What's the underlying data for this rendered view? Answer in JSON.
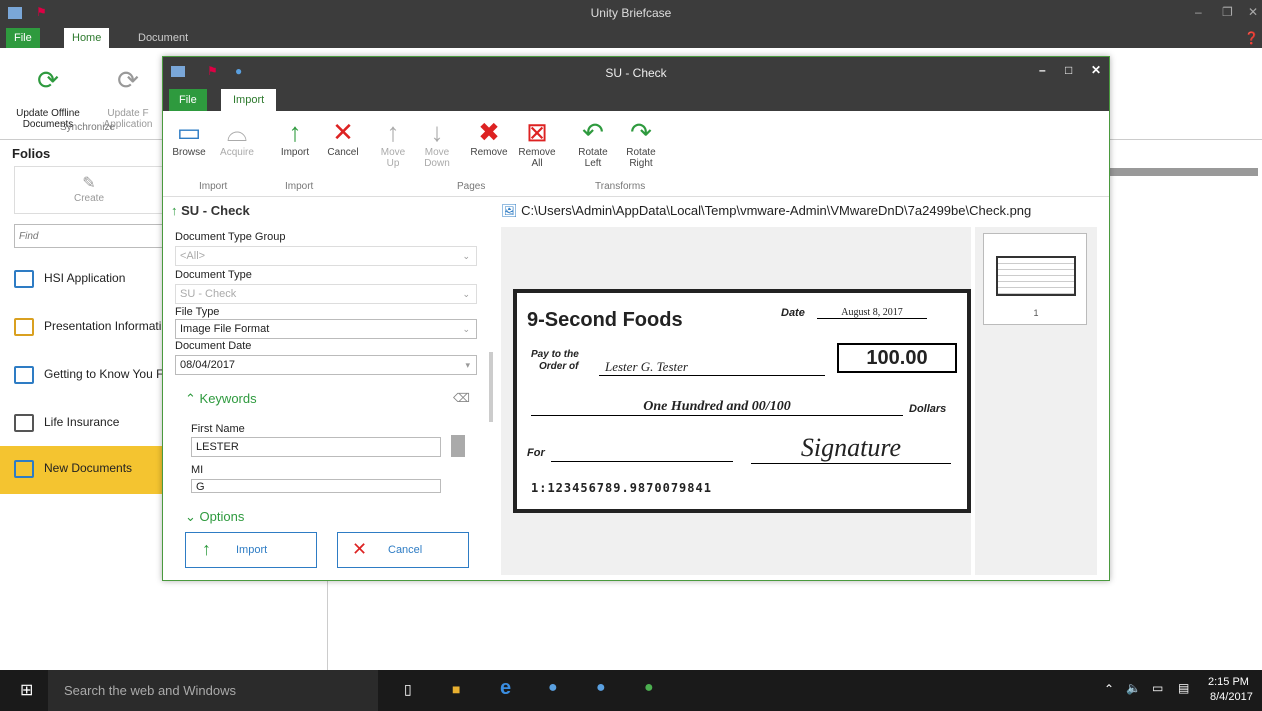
{
  "outer": {
    "title": "Unity Briefcase",
    "tabs": [
      "File",
      "Home",
      "Document"
    ],
    "ribbon": {
      "update_offline": "Update Offline\nDocuments",
      "update_app": "Update F\nApplication",
      "group": "Synchronize"
    },
    "folios_title": "Folios",
    "create_label": "Create",
    "find_placeholder": "Find",
    "folios": [
      "HSI Application",
      "Presentation Informati",
      "Getting to Know You F",
      "Life Insurance",
      "New Documents"
    ]
  },
  "dialog": {
    "title": "SU - Check",
    "tabs": [
      "File",
      "Import"
    ],
    "ribbon": {
      "browse": "Browse",
      "acquire": "Acquire",
      "import": "Import",
      "cancel": "Cancel",
      "move_up": "Move\nUp",
      "move_down": "Move\nDown",
      "remove": "Remove",
      "remove_all": "Remove\nAll",
      "rotate_left": "Rotate\nLeft",
      "rotate_right": "Rotate\nRight",
      "groups": [
        "Import",
        "Import",
        "Pages",
        "Transforms"
      ]
    },
    "pane_title": "SU - Check",
    "file_path": "C:\\Users\\Admin\\AppData\\Local\\Temp\\vmware-Admin\\VMwareDnD\\7a2499be\\Check.png",
    "fields": {
      "doc_type_group_label": "Document Type Group",
      "doc_type_group_value": "<All>",
      "doc_type_label": "Document Type",
      "doc_type_value": "SU - Check",
      "file_type_label": "File Type",
      "file_type_value": "Image File Format",
      "doc_date_label": "Document Date",
      "doc_date_value": "08/04/2017"
    },
    "keywords_label": "Keywords",
    "first_name_label": "First Name",
    "first_name_value": "LESTER",
    "mi_label": "MI",
    "mi_value": "G",
    "options_label": "Options",
    "import_button": "Import",
    "cancel_button": "Cancel",
    "thumb_page": "1"
  },
  "check": {
    "company": "9-Second Foods",
    "date_label": "Date",
    "date_value": "August 8, 2017",
    "pay_label_1": "Pay to the",
    "pay_label_2": "Order of",
    "payee": "Lester G. Tester",
    "amount": "100.00",
    "amount_words": "One Hundred and 00/100",
    "dollars": "Dollars",
    "for_label": "For",
    "signature": "Signature",
    "micr": "1:123456789.9870079841"
  },
  "taskbar": {
    "search_placeholder": "Search the web and Windows",
    "time": "2:15 PM",
    "date": "8/4/2017"
  }
}
